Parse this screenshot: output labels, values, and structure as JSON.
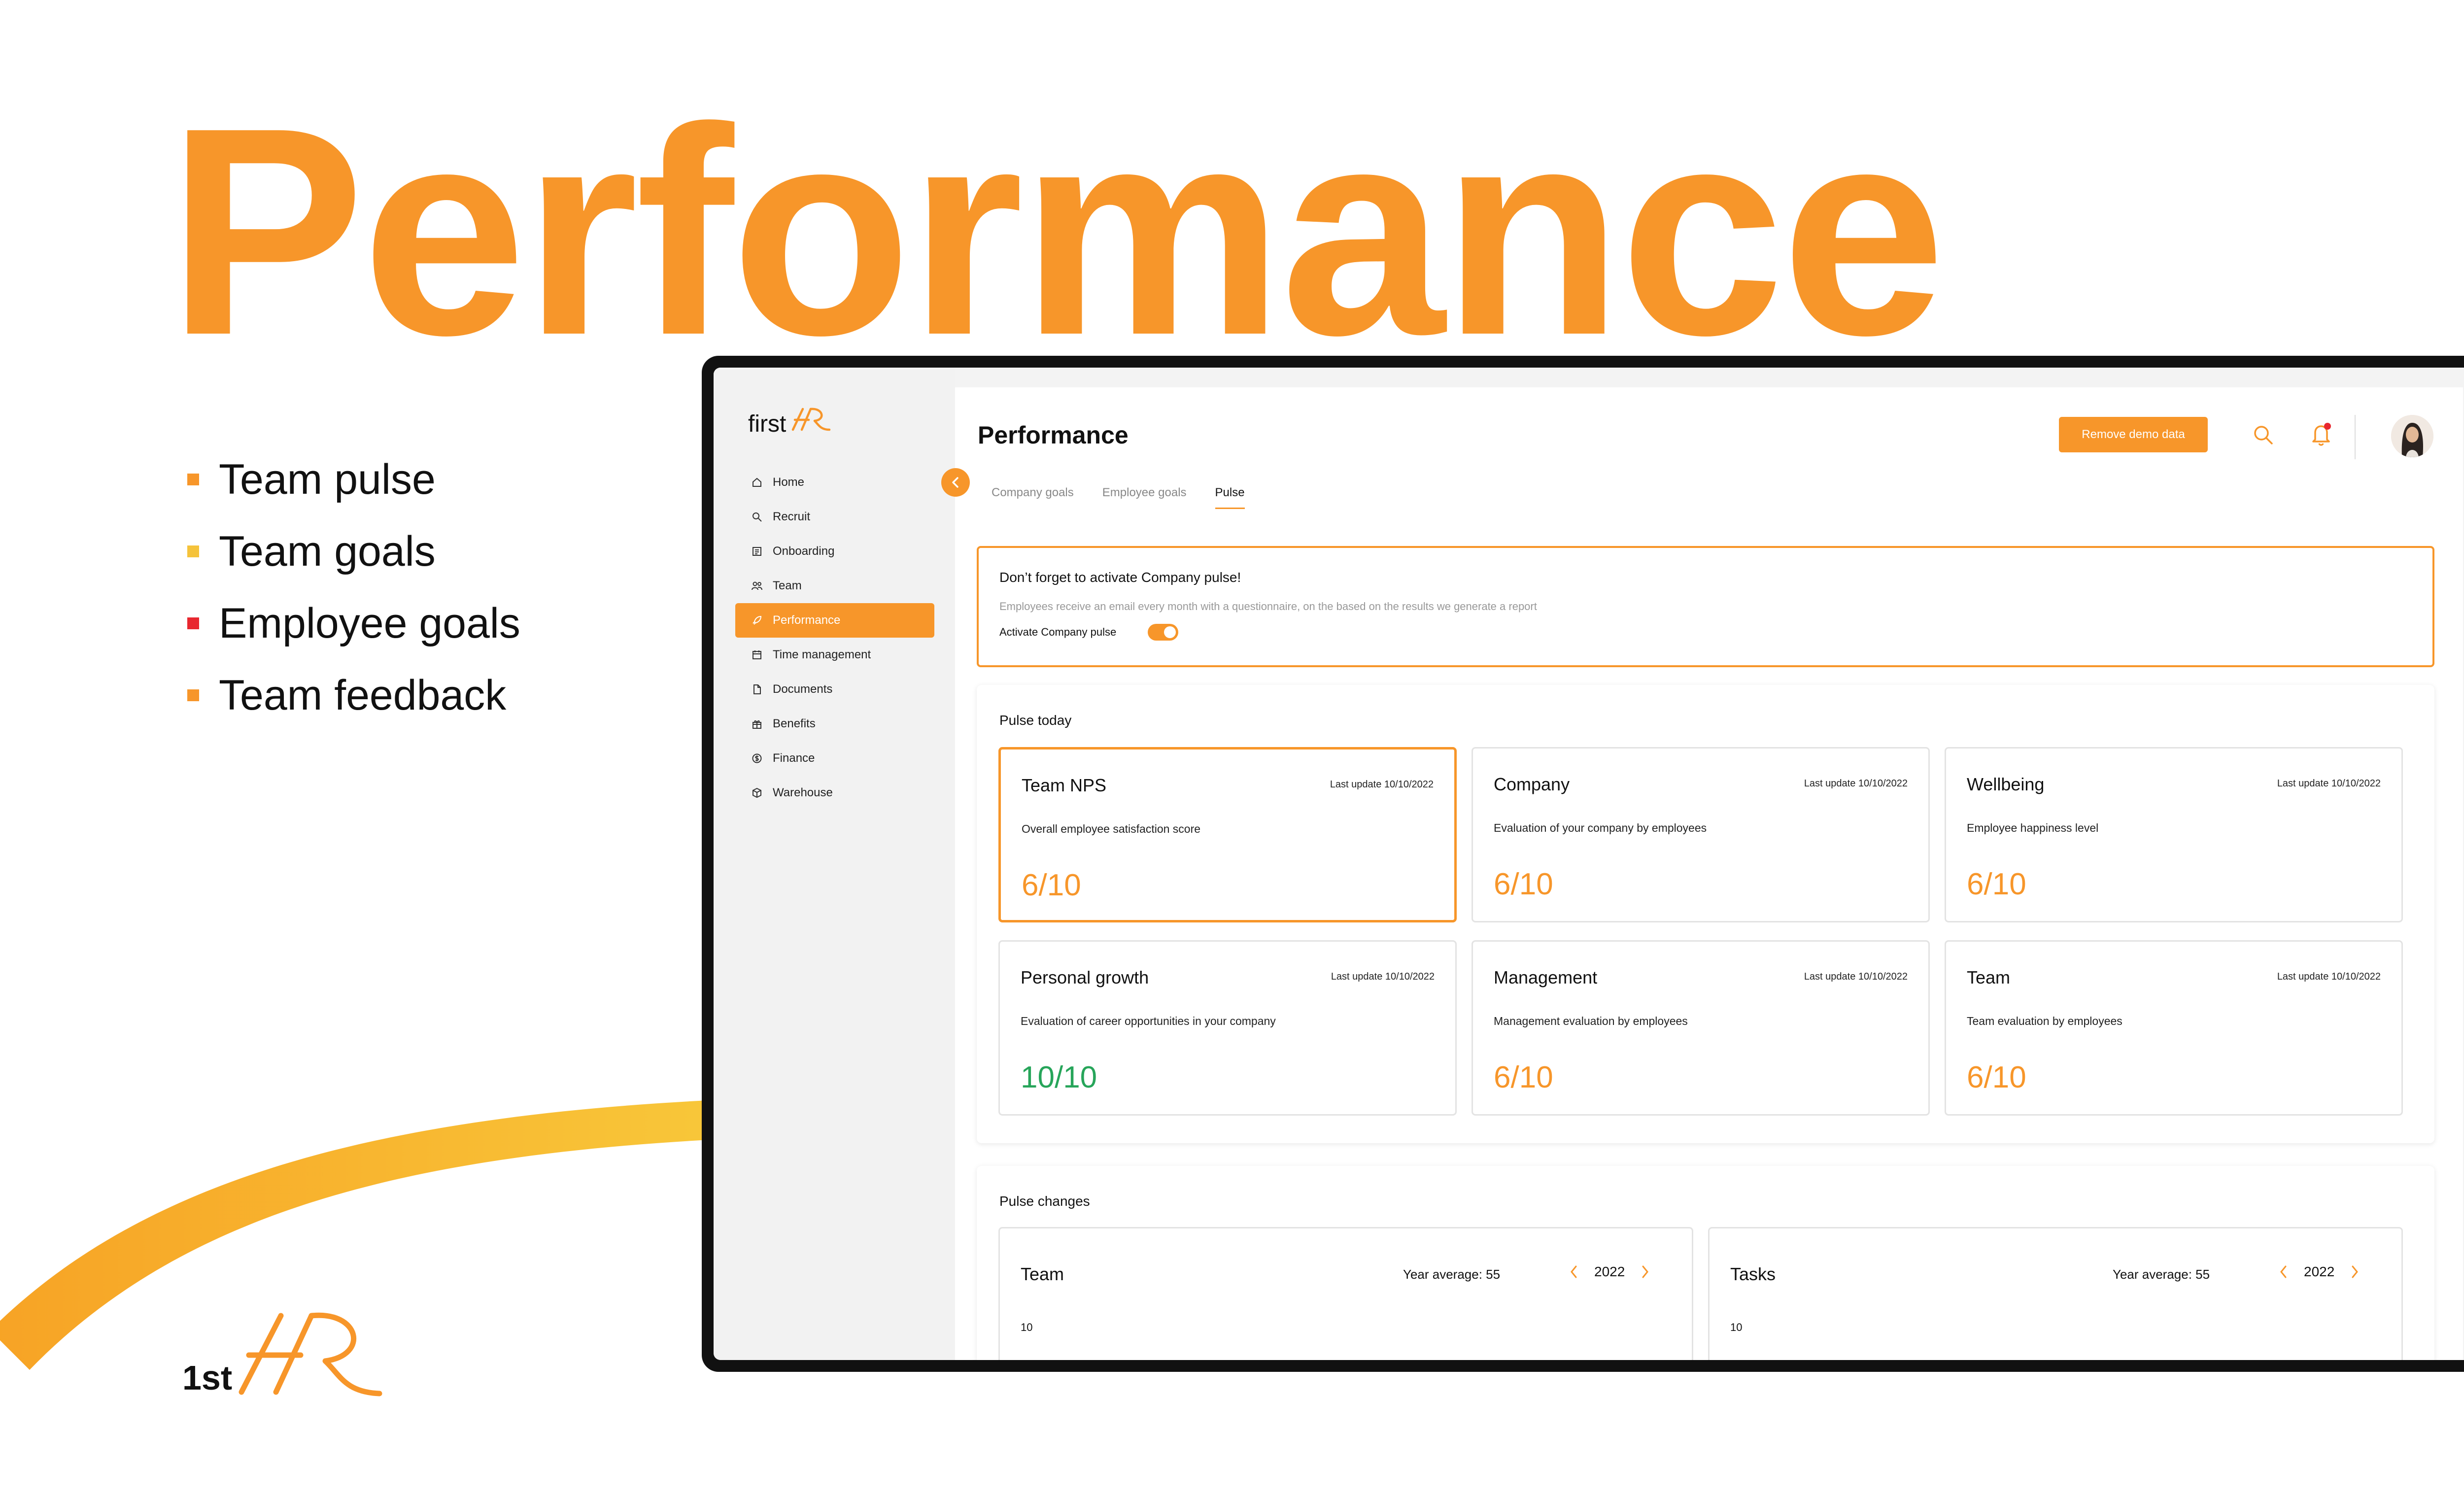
{
  "hero": {
    "title": "Performance"
  },
  "bullets": [
    {
      "label": "Team pulse",
      "color": "#F7962A"
    },
    {
      "label": "Team goals",
      "color": "#F5C33B"
    },
    {
      "label": "Employee goals",
      "color": "#E8272F"
    },
    {
      "label": "Team feedback",
      "color": "#F7962A"
    }
  ],
  "brand_logo": {
    "prefix": "1st",
    "mark": "HR"
  },
  "app": {
    "logo": {
      "text": "first",
      "mark": "HR"
    },
    "sidebar": {
      "items": [
        {
          "label": "Home",
          "icon": "home-icon"
        },
        {
          "label": "Recruit",
          "icon": "search-user-icon"
        },
        {
          "label": "Onboarding",
          "icon": "onboarding-icon"
        },
        {
          "label": "Team",
          "icon": "team-icon"
        },
        {
          "label": "Performance",
          "icon": "rocket-icon",
          "active": true
        },
        {
          "label": "Time management",
          "icon": "calendar-icon"
        },
        {
          "label": "Documents",
          "icon": "document-icon"
        },
        {
          "label": "Benefits",
          "icon": "gift-icon"
        },
        {
          "label": "Finance",
          "icon": "dollar-icon"
        },
        {
          "label": "Warehouse",
          "icon": "box-icon"
        }
      ]
    },
    "header": {
      "title": "Performance",
      "remove_demo_label": "Remove demo data"
    },
    "tabs": [
      {
        "label": "Company goals",
        "active": false
      },
      {
        "label": "Employee goals",
        "active": false
      },
      {
        "label": "Pulse",
        "active": true
      }
    ],
    "alert": {
      "title": "Don’t forget to activate Company pulse!",
      "description": "Employees receive an email every month with a questionnaire, on the based on the results we generate a report",
      "toggle_label": "Activate Company pulse",
      "toggle_on": true
    },
    "pulse_today": {
      "title": "Pulse today",
      "cards": [
        {
          "title": "Team NPS",
          "updated": "Last update 10/10/2022",
          "description": "Overall employee satisfaction score",
          "score": "6/10",
          "highlight": true
        },
        {
          "title": "Company",
          "updated": "Last update 10/10/2022",
          "description": "Evaluation of your company by employees",
          "score": "6/10"
        },
        {
          "title": "Wellbeing",
          "updated": "Last update 10/10/2022",
          "description": "Employee happiness level",
          "score": "6/10"
        },
        {
          "title": "Personal growth",
          "updated": "Last update 10/10/2022",
          "description": "Evaluation of career opportunities in your company",
          "score": "10/10",
          "good": true
        },
        {
          "title": "Management",
          "updated": "Last update 10/10/2022",
          "description": "Management evaluation by employees",
          "score": "6/10"
        },
        {
          "title": "Team",
          "updated": "Last update 10/10/2022",
          "description": "Team evaluation by employees",
          "score": "6/10"
        }
      ]
    },
    "pulse_changes": {
      "title": "Pulse changes",
      "charts": [
        {
          "title": "Team",
          "year_average": "Year average: 55",
          "year": "2022",
          "y_top_tick": "10"
        },
        {
          "title": "Tasks",
          "year_average": "Year average: 55",
          "year": "2022",
          "y_top_tick": "10"
        }
      ]
    }
  },
  "colors": {
    "accent": "#F7962A",
    "good": "#27A55A",
    "swoosh": "#F5C33B",
    "alert_dot": "#E8272F"
  }
}
